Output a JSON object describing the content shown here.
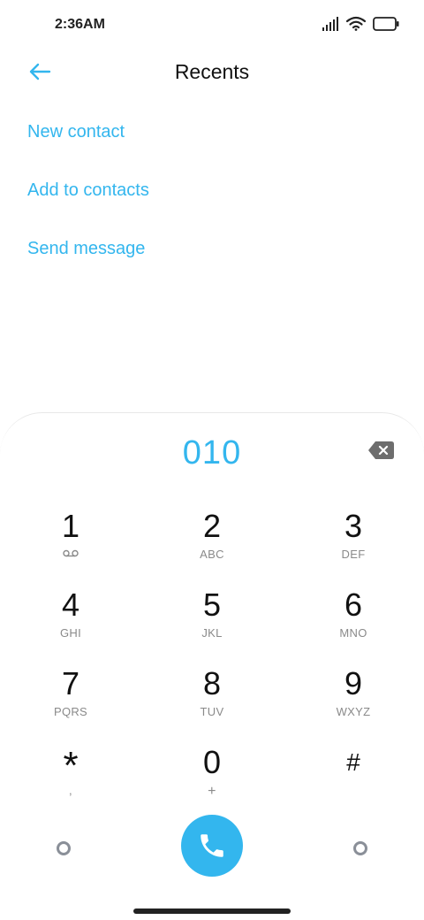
{
  "status_bar": {
    "time": "2:36AM",
    "icons": [
      "signal-icon",
      "wifi-icon",
      "battery-icon"
    ]
  },
  "header": {
    "title": "Recents",
    "back_icon": "arrow-left-icon"
  },
  "actions": [
    {
      "label": "New contact"
    },
    {
      "label": "Add to contacts"
    },
    {
      "label": "Send message"
    }
  ],
  "dialpad": {
    "number": "010",
    "keys": [
      {
        "digit": "1",
        "letters": ""
      },
      {
        "digit": "2",
        "letters": "ABC"
      },
      {
        "digit": "3",
        "letters": "DEF"
      },
      {
        "digit": "4",
        "letters": "GHI"
      },
      {
        "digit": "5",
        "letters": "JKL"
      },
      {
        "digit": "6",
        "letters": "MNO"
      },
      {
        "digit": "7",
        "letters": "PQRS"
      },
      {
        "digit": "8",
        "letters": "TUV"
      },
      {
        "digit": "9",
        "letters": "WXYZ"
      },
      {
        "digit": "*",
        "letters": ","
      },
      {
        "digit": "0",
        "letters": "+"
      },
      {
        "digit": "#",
        "letters": ""
      }
    ]
  },
  "colors": {
    "accent": "#33b6ee",
    "text": "#111111",
    "subtext": "#8a8a8a"
  }
}
